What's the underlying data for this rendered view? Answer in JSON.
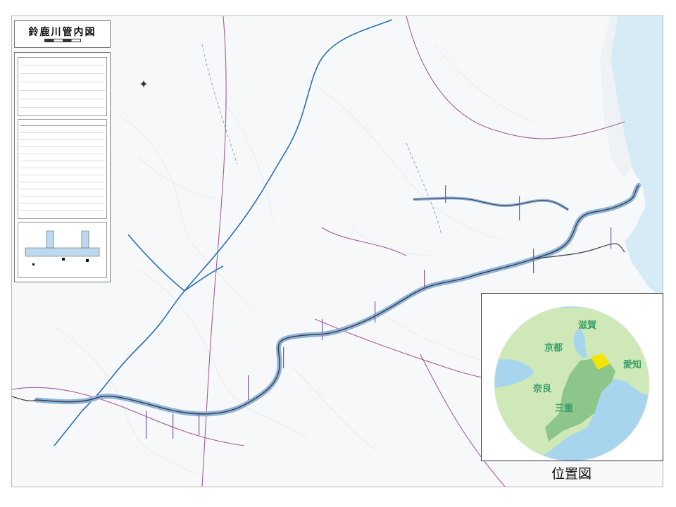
{
  "map": {
    "title": "鈴鹿川管内図",
    "compass_icon": "compass-rose-icon",
    "colors": {
      "river_channel": "#3a3f4a",
      "river_highlight": "#8fb3d9",
      "sea": "#cfe6f5",
      "expressway": "#2a6fb8",
      "national_road": "#a45c9b",
      "background": "#f7f8f9"
    }
  },
  "inset": {
    "caption": "位置図",
    "labels": {
      "shiga": "滋賀",
      "kyoto": "京都",
      "aichi": "愛知",
      "nara": "奈良",
      "mie": "三重"
    },
    "colors": {
      "land": "#cfe8b8",
      "mie": "#8cc68a",
      "sea": "#a8d5ee",
      "highlight": "#f2e600"
    }
  }
}
